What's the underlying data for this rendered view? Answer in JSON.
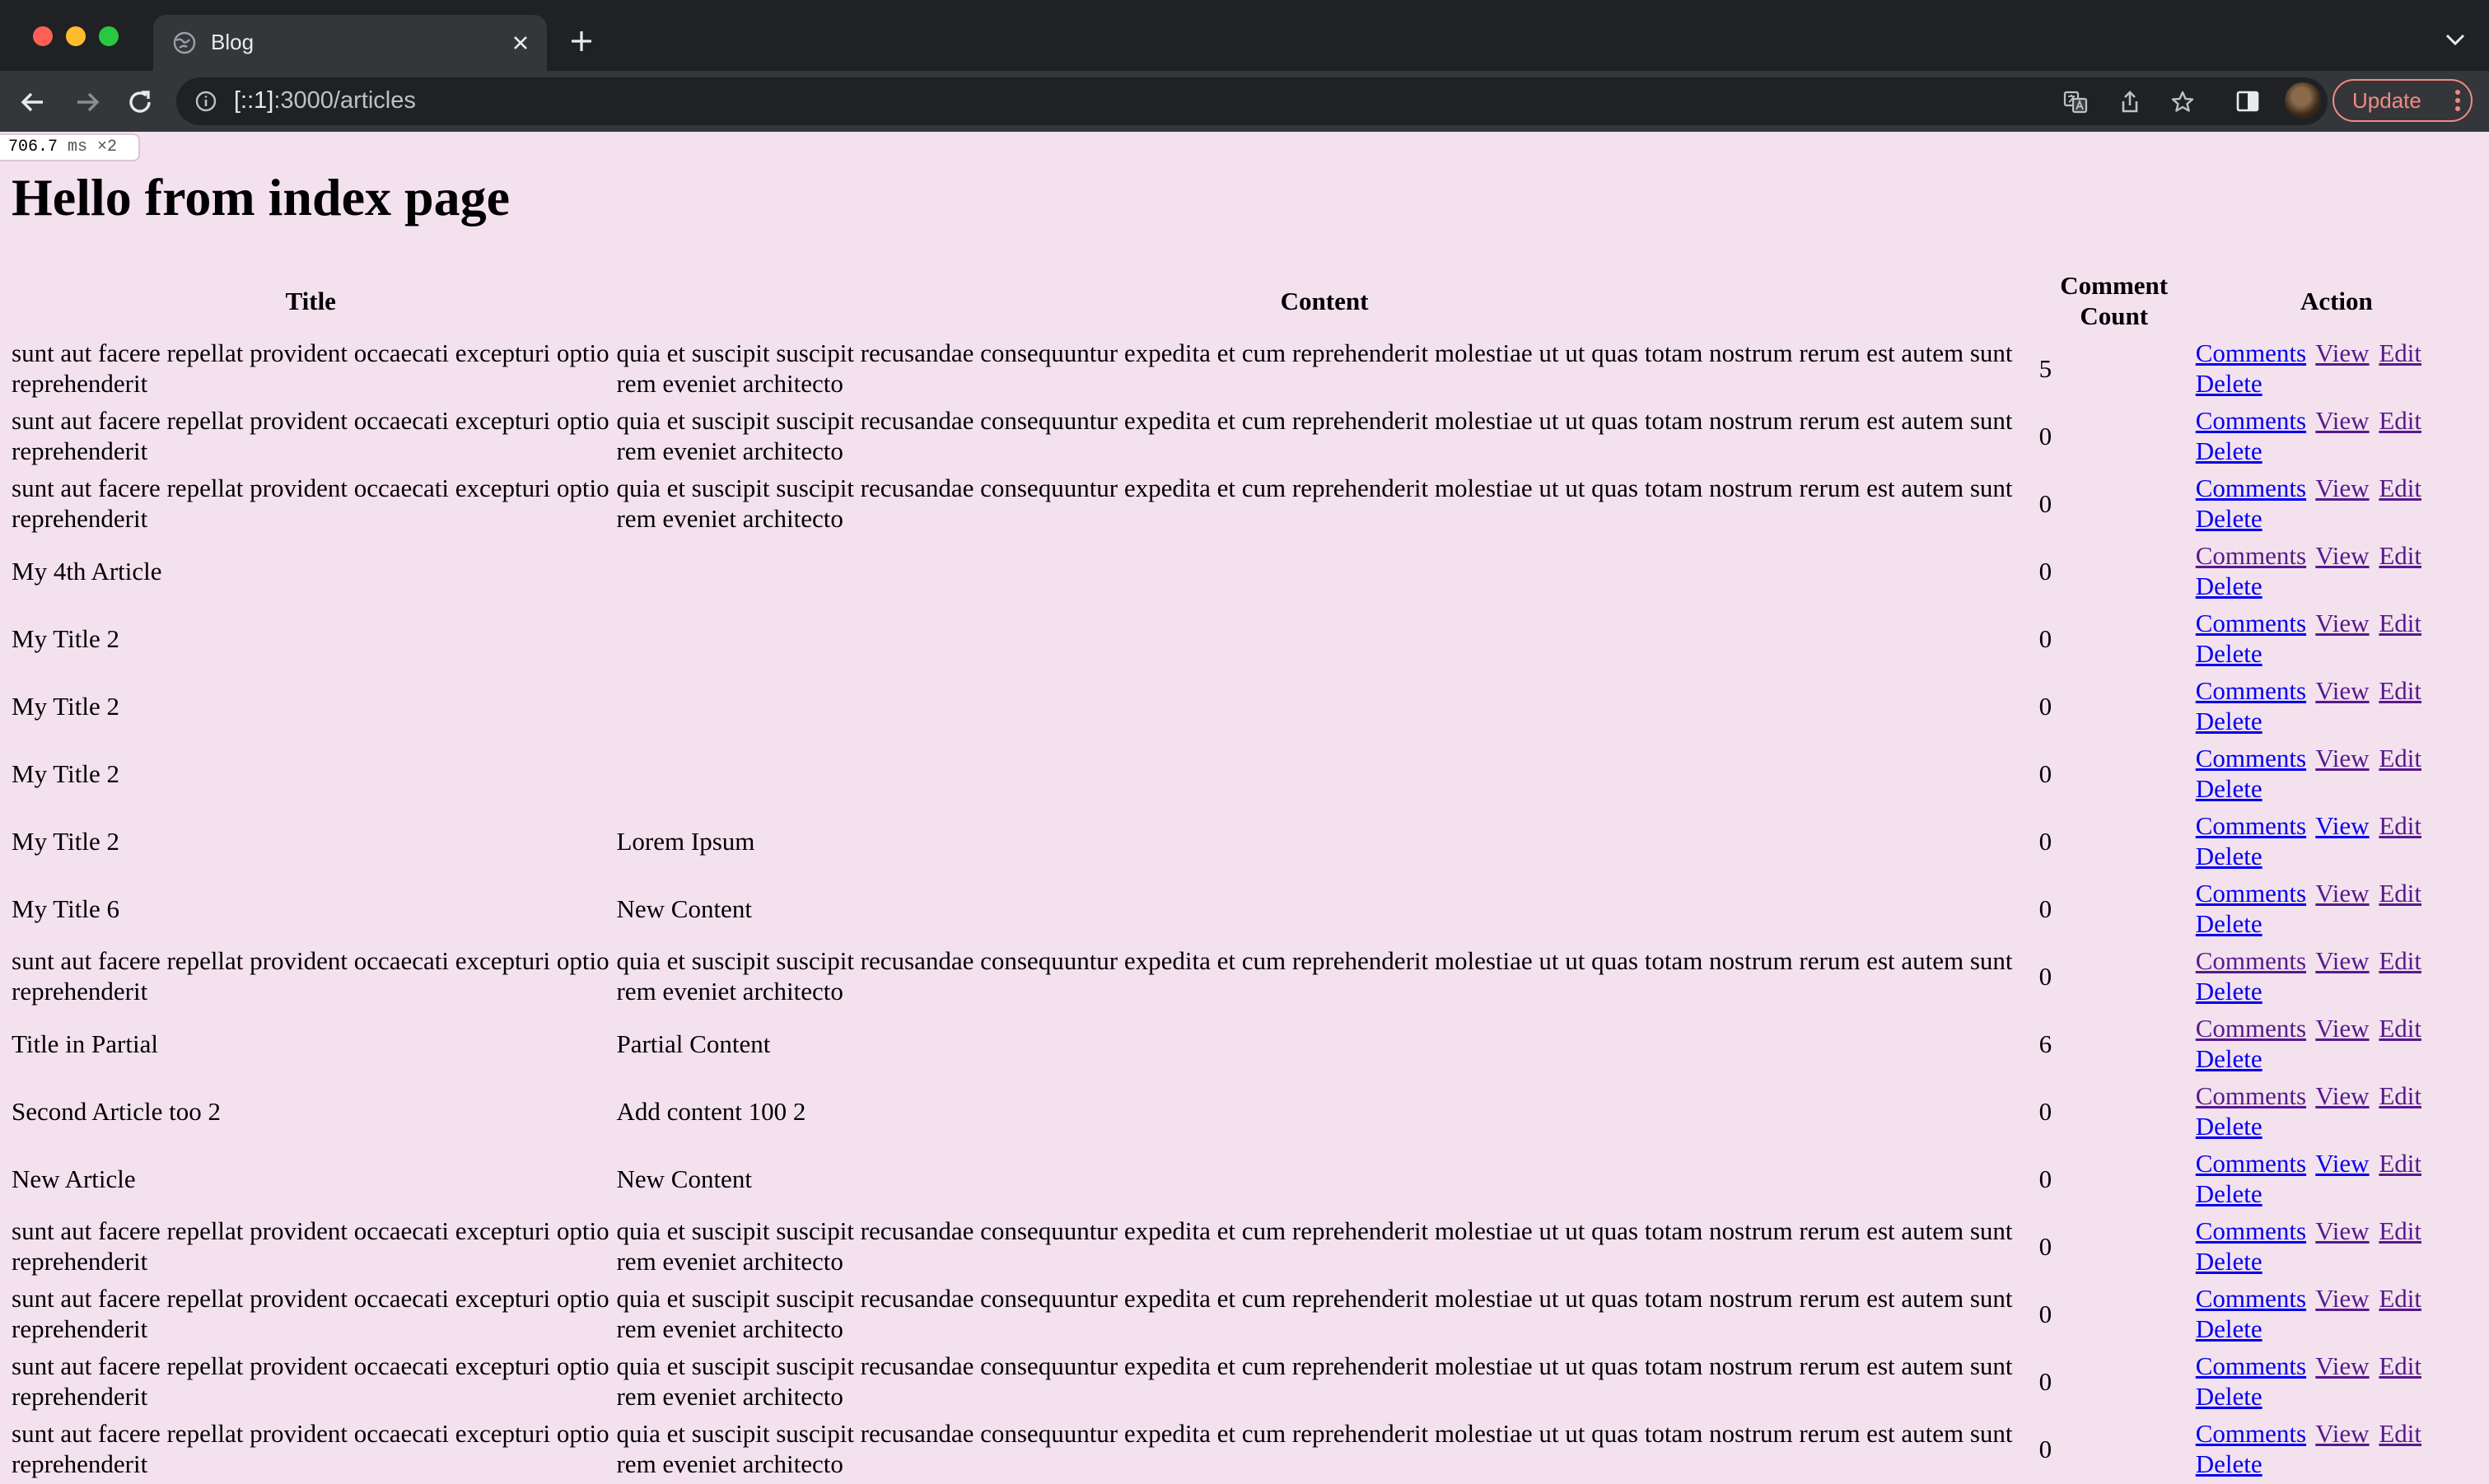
{
  "browser": {
    "tab_title": "Blog",
    "url_host": "[::1]",
    "url_path": ":3000/articles",
    "update_label": "Update"
  },
  "perf": {
    "value": "706.7",
    "unit": "ms ×2"
  },
  "page": {
    "heading": "Hello from index page",
    "columns": [
      "Title",
      "Content",
      "Comment Count",
      "Action"
    ],
    "action_labels": {
      "comments": "Comments",
      "view": "View",
      "edit": "Edit",
      "delete": "Delete"
    },
    "rows": [
      {
        "title": "sunt aut facere repellat provident occaecati excepturi optio reprehenderit",
        "content": "quia et suscipit suscipit recusandae consequuntur expedita et cum reprehenderit molestiae ut ut quas totam nostrum rerum est autem sunt rem eveniet architecto",
        "count": "5"
      },
      {
        "title": "sunt aut facere repellat provident occaecati excepturi optio reprehenderit",
        "content": "quia et suscipit suscipit recusandae consequuntur expedita et cum reprehenderit molestiae ut ut quas totam nostrum rerum est autem sunt rem eveniet architecto",
        "count": "0"
      },
      {
        "title": "sunt aut facere repellat provident occaecati excepturi optio reprehenderit",
        "content": "quia et suscipit suscipit recusandae consequuntur expedita et cum reprehenderit molestiae ut ut quas totam nostrum rerum est autem sunt rem eveniet architecto",
        "count": "0"
      },
      {
        "title": "My 4th Article",
        "content": "",
        "count": "0"
      },
      {
        "title": "My Title 2",
        "content": "",
        "count": "0"
      },
      {
        "title": "My Title 2",
        "content": "",
        "count": "0"
      },
      {
        "title": "My Title 2",
        "content": "",
        "count": "0"
      },
      {
        "title": "My Title 2",
        "content": "Lorem Ipsum",
        "count": "0"
      },
      {
        "title": "My Title 6",
        "content": "New Content",
        "count": "0"
      },
      {
        "title": "sunt aut facere repellat provident occaecati excepturi optio reprehenderit",
        "content": "quia et suscipit suscipit recusandae consequuntur expedita et cum reprehenderit molestiae ut ut quas totam nostrum rerum est autem sunt rem eveniet architecto",
        "count": "0"
      },
      {
        "title": "Title in Partial",
        "content": "Partial Content",
        "count": "6"
      },
      {
        "title": "Second Article too 2",
        "content": "Add content 100 2",
        "count": "0"
      },
      {
        "title": "New Article",
        "content": "New Content",
        "count": "0"
      },
      {
        "title": "sunt aut facere repellat provident occaecati excepturi optio reprehenderit",
        "content": "quia et suscipit suscipit recusandae consequuntur expedita et cum reprehenderit molestiae ut ut quas totam nostrum rerum est autem sunt rem eveniet architecto",
        "count": "0"
      },
      {
        "title": "sunt aut facere repellat provident occaecati excepturi optio reprehenderit",
        "content": "quia et suscipit suscipit recusandae consequuntur expedita et cum reprehenderit molestiae ut ut quas totam nostrum rerum est autem sunt rem eveniet architecto",
        "count": "0"
      },
      {
        "title": "sunt aut facere repellat provident occaecati excepturi optio reprehenderit",
        "content": "quia et suscipit suscipit recusandae consequuntur expedita et cum reprehenderit molestiae ut ut quas totam nostrum rerum est autem sunt rem eveniet architecto",
        "count": "0"
      },
      {
        "title": "sunt aut facere repellat provident occaecati excepturi optio reprehenderit",
        "content": "quia et suscipit suscipit recusandae consequuntur expedita et cum reprehenderit molestiae ut ut quas totam nostrum rerum est autem sunt rem eveniet architecto",
        "count": "0"
      }
    ]
  }
}
